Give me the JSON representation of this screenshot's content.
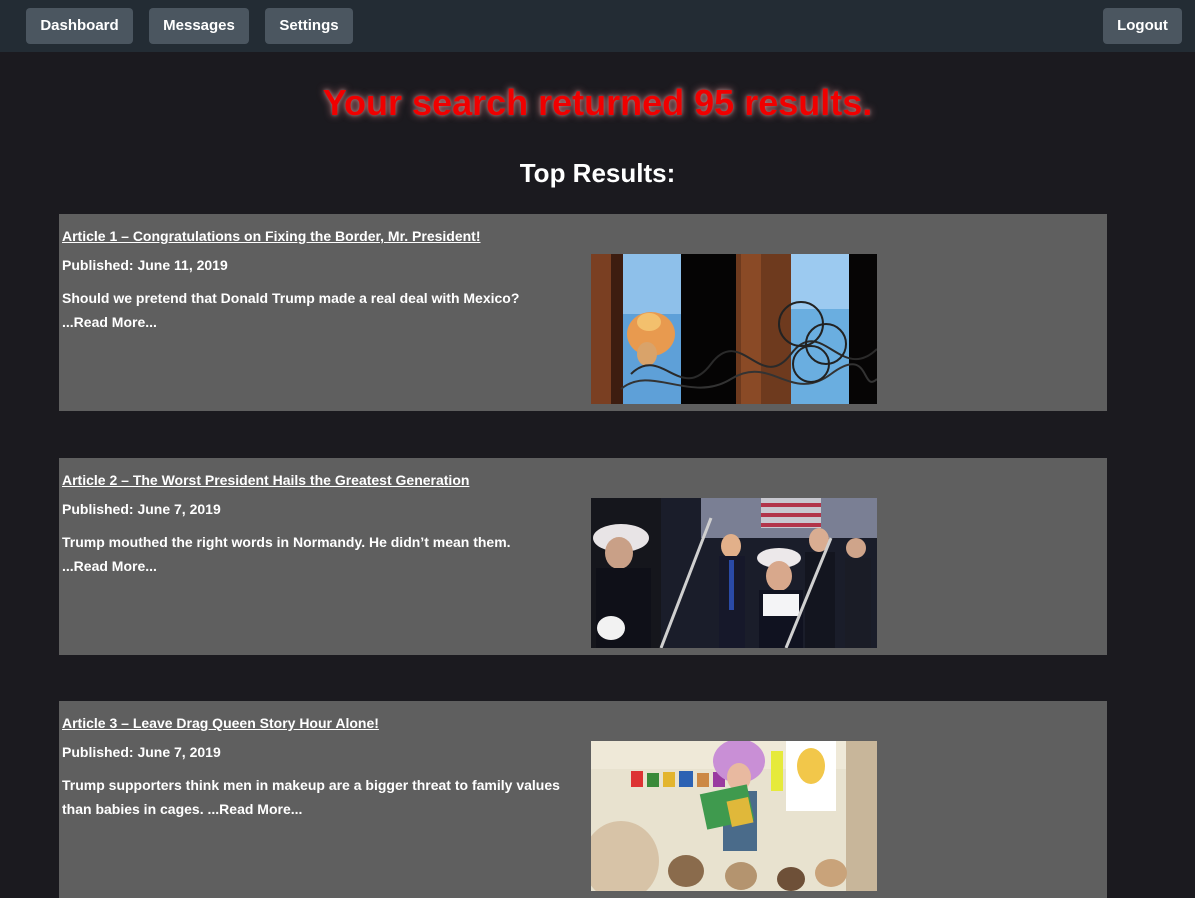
{
  "nav": {
    "dashboard": "Dashboard",
    "messages": "Messages",
    "settings": "Settings",
    "logout": "Logout"
  },
  "headline": "Your search returned 95 results.",
  "subhead": "Top Results:",
  "articles": [
    {
      "title": "Article 1 – Congratulations on Fixing the Border, Mr. President!",
      "published": "Published: June 11, 2019",
      "summary": "Should we pretend that Donald Trump made a real deal with Mexico?",
      "read_more": "...Read More...",
      "image": "border-fence-photo"
    },
    {
      "title": "Article 2 – The Worst President Hails the Greatest Generation",
      "published": "Published: June 7, 2019",
      "summary": "Trump mouthed the right words in Normandy. He didn’t mean them.",
      "read_more": "...Read More...",
      "image": "normandy-ceremony-photo"
    },
    {
      "title": "Article 3 – Leave Drag Queen Story Hour Alone!",
      "published": "Published: June 7, 2019",
      "summary": "Trump supporters think men in makeup are a bigger threat to family values than babies in cages.",
      "read_more": "...Read More...",
      "image": "story-hour-photo"
    }
  ],
  "colors": {
    "background": "#1b1a1f",
    "topbar": "#232c34",
    "nav_button": "#4b5660",
    "card": "#5f5f5f",
    "headline": "#f00000"
  }
}
